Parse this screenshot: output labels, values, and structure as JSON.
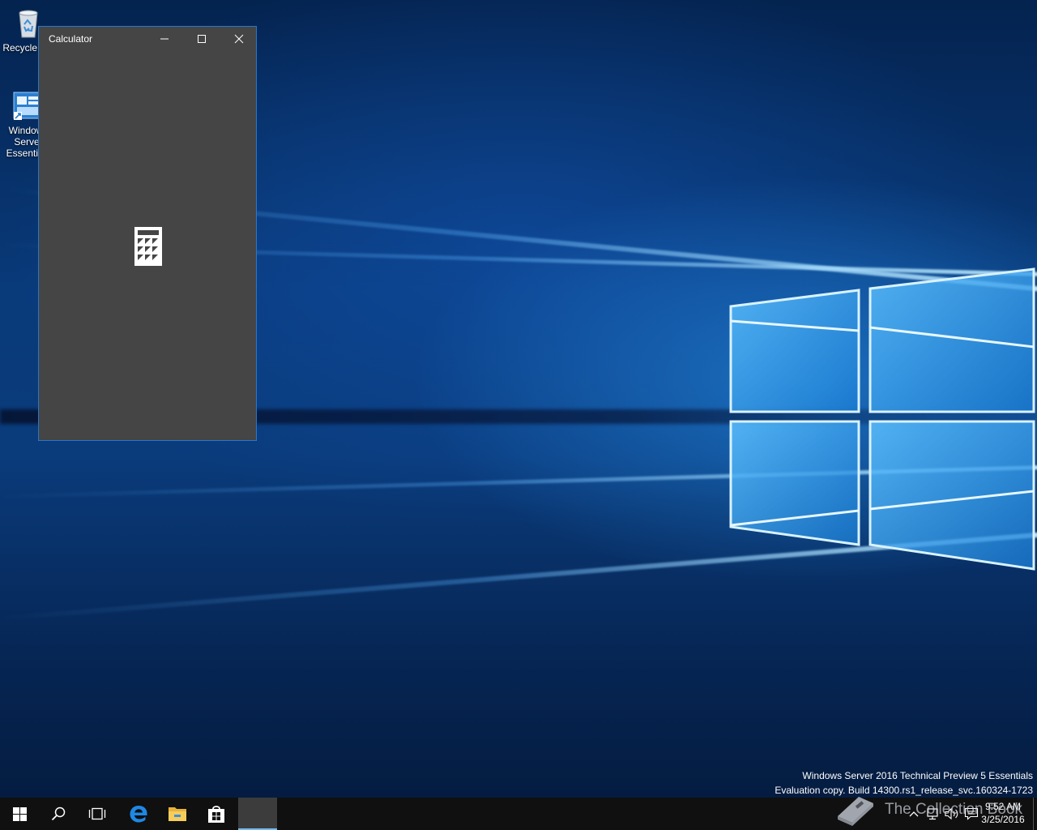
{
  "desktop": {
    "icons": [
      {
        "label": "Recycle Bin",
        "icon": "recycle-bin-icon"
      },
      {
        "label": "Windows Server Essentials",
        "icon": "server-dashboard-icon"
      }
    ],
    "watermark": {
      "line1": "Windows Server 2016 Technical Preview 5 Essentials",
      "line2": "Evaluation copy. Build 14300.rs1_release_svc.160324-1723"
    },
    "overlay_brand": "The Collection Book"
  },
  "calculator": {
    "title": "Calculator",
    "splash_icon": "calculator-icon",
    "colors": {
      "background": "#454545",
      "border": "#2a77c9"
    }
  },
  "taskbar": {
    "buttons": [
      {
        "name": "start",
        "icon": "windows-start-icon"
      },
      {
        "name": "search",
        "icon": "search-icon"
      },
      {
        "name": "task-view",
        "icon": "task-view-icon"
      },
      {
        "name": "edge",
        "icon": "edge-icon"
      },
      {
        "name": "file-explorer",
        "icon": "folder-icon"
      },
      {
        "name": "store",
        "icon": "store-icon"
      },
      {
        "name": "calculator",
        "icon": "calculator-icon",
        "active": true
      }
    ],
    "tray": [
      "chevron-up-icon",
      "network-icon",
      "volume-icon",
      "action-center-icon"
    ],
    "clock": {
      "time": "9:52 AM",
      "date": "3/25/2016"
    },
    "colors": {
      "background": "#101010",
      "active_indicator": "#76b9ed"
    }
  }
}
